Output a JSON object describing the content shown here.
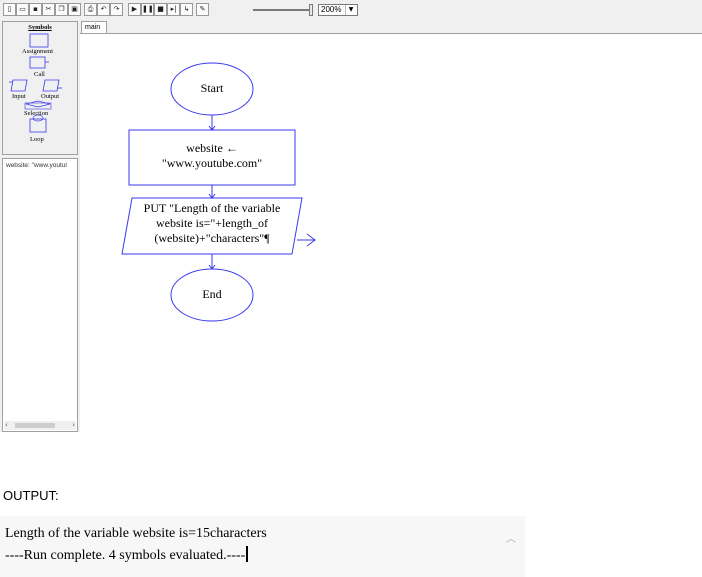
{
  "toolbar": {
    "buttons": [
      {
        "icon": "new-file-icon",
        "glyph": "▯"
      },
      {
        "icon": "open-folder-icon",
        "glyph": "▭"
      },
      {
        "icon": "save-icon",
        "glyph": "▪"
      },
      {
        "icon": "cut-icon",
        "glyph": "✂"
      },
      {
        "icon": "copy-icon",
        "glyph": "❐"
      },
      {
        "icon": "paste-icon",
        "glyph": "▣"
      },
      {
        "icon": "print-icon",
        "glyph": "⎙"
      },
      {
        "icon": "undo-icon",
        "glyph": "↶"
      },
      {
        "icon": "redo-icon",
        "glyph": "↷"
      },
      {
        "icon": "run-icon",
        "glyph": "▶"
      },
      {
        "icon": "pause-icon",
        "glyph": "❚❚"
      },
      {
        "icon": "stop-icon",
        "glyph": "■"
      },
      {
        "icon": "step-icon",
        "glyph": "▸|"
      },
      {
        "icon": "step-into-icon",
        "glyph": "↳"
      },
      {
        "icon": "pen-icon",
        "glyph": "✎"
      }
    ],
    "zoom": {
      "value": "200%"
    }
  },
  "symbols": {
    "title": "Symbols",
    "assignment": "Assignment",
    "call": "Call",
    "input": "Input",
    "output": "Output",
    "selection": "Selection",
    "loop": "Loop"
  },
  "variables": {
    "item": "website: \"www.youtul"
  },
  "tabs": {
    "main": "main"
  },
  "flowchart": {
    "start": "Start",
    "assign_line1": "website ←",
    "assign_line2": "\"www.youtube.com\"",
    "output_line1": "PUT \"Length of the variable",
    "output_line2": "website is=\"+length_of",
    "output_line3": "(website)+\"characters\"¶",
    "end": "End"
  },
  "output": {
    "heading": "OUTPUT:",
    "line1": "Length of the variable website is=15characters",
    "line2": "----Run complete.  4 symbols evaluated.----"
  },
  "colors": {
    "flow_stroke": "#3a3af0"
  }
}
